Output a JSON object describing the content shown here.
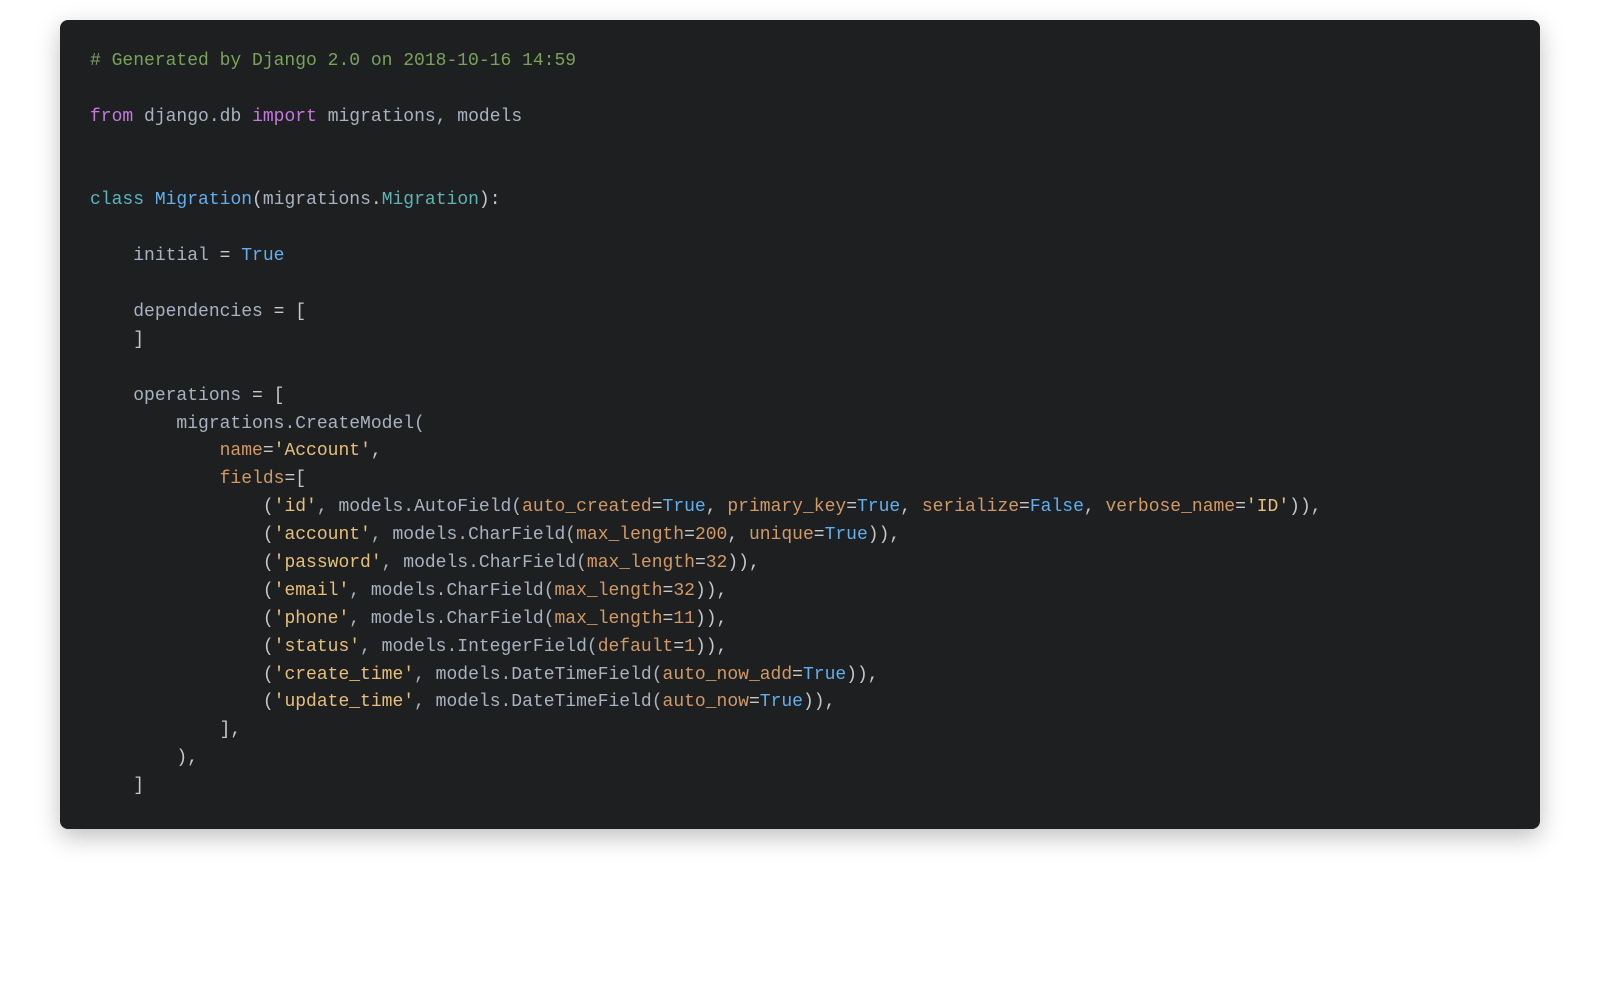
{
  "code": {
    "comment": "# Generated by Django 2.0 on 2018-10-16 14:59",
    "imp": {
      "from": "from",
      "module": "django.db",
      "import": "import",
      "names": "migrations, models"
    },
    "cls": {
      "kw": "class",
      "name": "Migration",
      "base1": "migrations",
      "dot": ".",
      "base2": "Migration",
      "colon": "):"
    },
    "initial": {
      "name": "initial",
      "eq": " = ",
      "val": "True"
    },
    "deps": {
      "name": "dependencies",
      "eq": " = [",
      "close": "]"
    },
    "ops": {
      "name": "operations",
      "eq": " = [",
      "create": "migrations.CreateModel(",
      "name_param": "name",
      "name_eq": "=",
      "name_val": "'Account'",
      "comma": ",",
      "fields_param": "fields",
      "fields_eq": "=[",
      "f0": {
        "open": "(",
        "name": "'id'",
        "sep": ", models.AutoField(",
        "p1": "auto_created",
        "p1v": "True",
        "p2": "primary_key",
        "p2v": "True",
        "p3": "serialize",
        "p3v": "False",
        "p4": "verbose_name",
        "p4v": "'ID'",
        "close": ")),"
      },
      "f1": {
        "open": "(",
        "name": "'account'",
        "sep": ", models.CharField(",
        "p1": "max_length",
        "p1v": "200",
        "p2": "unique",
        "p2v": "True",
        "close": ")),"
      },
      "f2": {
        "open": "(",
        "name": "'password'",
        "sep": ", models.CharField(",
        "p1": "max_length",
        "p1v": "32",
        "close": ")),"
      },
      "f3": {
        "open": "(",
        "name": "'email'",
        "sep": ", models.CharField(",
        "p1": "max_length",
        "p1v": "32",
        "close": ")),"
      },
      "f4": {
        "open": "(",
        "name": "'phone'",
        "sep": ", models.CharField(",
        "p1": "max_length",
        "p1v": "11",
        "close": ")),"
      },
      "f5": {
        "open": "(",
        "name": "'status'",
        "sep": ", models.IntegerField(",
        "p1": "default",
        "p1v": "1",
        "close": ")),"
      },
      "f6": {
        "open": "(",
        "name": "'create_time'",
        "sep": ", models.DateTimeField(",
        "p1": "auto_now_add",
        "p1v": "True",
        "close": ")),"
      },
      "f7": {
        "open": "(",
        "name": "'update_time'",
        "sep": ", models.DateTimeField(",
        "p1": "auto_now",
        "p1v": "True",
        "close": ")),"
      },
      "fields_close": "],",
      "create_close": "),",
      "ops_close": "]"
    }
  }
}
